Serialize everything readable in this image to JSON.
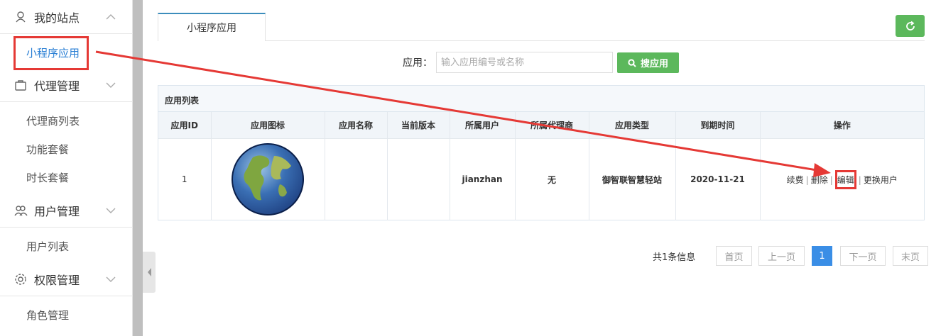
{
  "sidebar": {
    "groups": [
      {
        "label": "我的站点"
      },
      {
        "label": "代理管理"
      },
      {
        "label": "用户管理"
      },
      {
        "label": "权限管理"
      }
    ],
    "items": [
      {
        "label": "小程序应用"
      },
      {
        "label": "代理商列表"
      },
      {
        "label": "功能套餐"
      },
      {
        "label": "时长套餐"
      },
      {
        "label": "用户列表"
      },
      {
        "label": "角色管理"
      }
    ]
  },
  "tabs": [
    {
      "label": "小程序应用"
    }
  ],
  "search": {
    "label": "应用：",
    "placeholder": "输入应用编号或名称",
    "button": "搜应用"
  },
  "panel": {
    "title": "应用列表",
    "columns": [
      "应用ID",
      "应用图标",
      "应用名称",
      "当前版本",
      "所属用户",
      "所属代理商",
      "应用类型",
      "到期时间",
      "操作"
    ],
    "rows": [
      {
        "id": "1",
        "icon": "globe-icon",
        "name": "",
        "version": "",
        "user": "jianzhan",
        "agent": "无",
        "type": "御智联智慧轻站",
        "expire": "2020-11-21",
        "ops": [
          "续费",
          "删除",
          "编辑",
          "更换用户"
        ]
      }
    ]
  },
  "pagination": {
    "info": "共1条信息",
    "first": "首页",
    "prev": "上一页",
    "current": "1",
    "next": "下一页",
    "last": "末页"
  },
  "colors": {
    "accent": "#3a8ee6",
    "green": "#5cb85c",
    "annotation": "#e53935"
  }
}
